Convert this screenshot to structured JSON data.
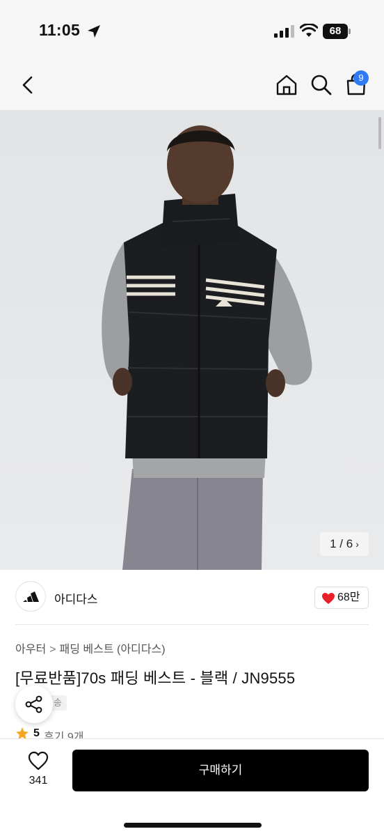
{
  "status_bar": {
    "time": "11:05",
    "battery": "68"
  },
  "nav": {
    "cart_badge": "9"
  },
  "gallery": {
    "counter": "1 / 6",
    "next_glyph": "›"
  },
  "brand": {
    "name": "아디다스",
    "likes": "68만"
  },
  "product": {
    "breadcrumb": [
      "아우터",
      "패딩 베스트 (아디다스)"
    ],
    "breadcrumb_sep": ">",
    "title": "[무료반품]70s 패딩 베스트 - 블랙 / JN9555",
    "shipping_tag": "송",
    "rating": "5",
    "reviews": "후기 9개"
  },
  "bottom_bar": {
    "wish_count": "341",
    "buy_label": "구매하기"
  },
  "colors": {
    "accent_badge": "#2f7bf5",
    "heart": "#e8202a",
    "star": "#f5a623",
    "buy_button": "#000000"
  },
  "icons": [
    "location-arrow-icon",
    "signal-icon",
    "wifi-icon",
    "battery-icon",
    "back-chevron-icon",
    "home-icon",
    "search-icon",
    "cart-icon",
    "heart-icon",
    "share-icon",
    "star-icon",
    "adidas-logo"
  ]
}
